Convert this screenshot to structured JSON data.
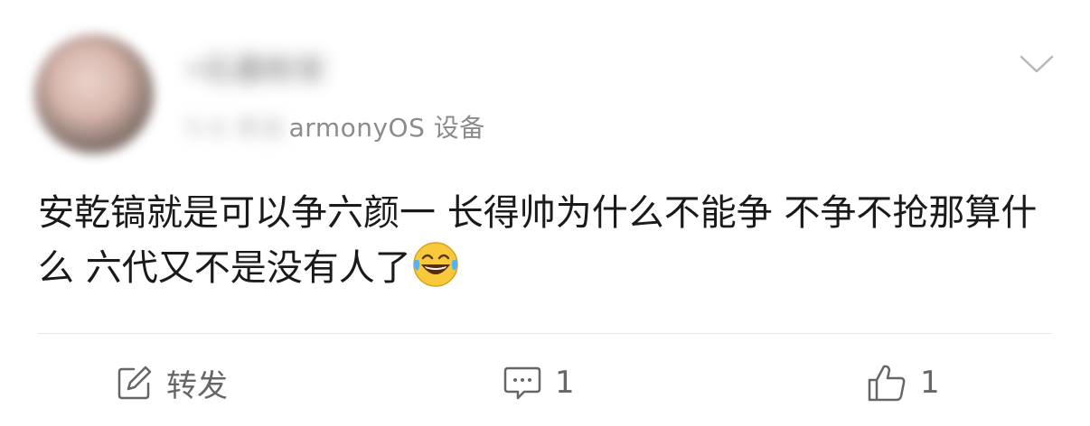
{
  "post": {
    "author_name": "•石墨粉安",
    "meta_blurred": "5-6 来自",
    "source_visible": "armonyOS 设备",
    "content": "安乾镐就是可以争六颜一 长得帅为什么不能争 不争不抢那算什么 六代又不是没有人了",
    "emoji": "laughing-tears-emoji"
  },
  "actions": {
    "repost_label": "转发",
    "comment_count": "1",
    "like_count": "1"
  },
  "colors": {
    "text": "#1a1a1a",
    "secondary": "#666666",
    "meta": "#8c8c8c",
    "divider": "#e8e8e8"
  }
}
